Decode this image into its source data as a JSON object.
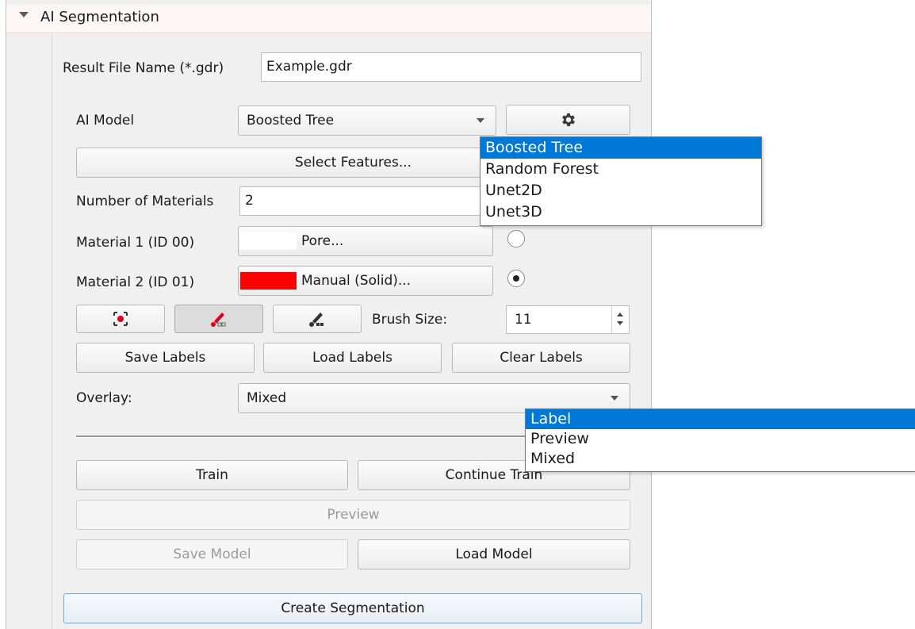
{
  "section": {
    "title": "AI Segmentation"
  },
  "result_file": {
    "label": "Result File Name (*.gdr)",
    "value": "Example.gdr"
  },
  "ai_model": {
    "label": "AI Model",
    "selected": "Boosted Tree",
    "options": [
      "Boosted Tree",
      "Random Forest",
      "Unet2D",
      "Unet3D"
    ]
  },
  "select_features": {
    "label": "Select Features..."
  },
  "num_materials": {
    "label": "Number of Materials",
    "value": "2"
  },
  "materials": [
    {
      "label": "Material 1 (ID 00)",
      "button": "Pore...",
      "color": "#ffffff",
      "selected": false
    },
    {
      "label": "Material 2 (ID 01)",
      "button": "Manual (Solid)...",
      "color": "#ff0000",
      "selected": true
    }
  ],
  "brush": {
    "label": "Brush Size:",
    "value": "11"
  },
  "labels_buttons": {
    "save": "Save Labels",
    "load": "Load Labels",
    "clear": "Clear Labels"
  },
  "overlay": {
    "label": "Overlay:",
    "selected": "Mixed",
    "options": [
      "Label",
      "Preview",
      "Mixed"
    ]
  },
  "train": {
    "train": "Train",
    "continue": "Continue Train"
  },
  "preview": {
    "label": "Preview"
  },
  "model": {
    "save": "Save Model",
    "load": "Load Model"
  },
  "create": {
    "label": "Create Segmentation"
  },
  "colors": {
    "selection": "#0078d7",
    "material2": "#ff0000",
    "icon_red": "#e0001b"
  },
  "icons": [
    "chevron-down-icon",
    "gear-icon",
    "brush-select-icon",
    "brush-paint-icon",
    "brush-erase-icon"
  ]
}
